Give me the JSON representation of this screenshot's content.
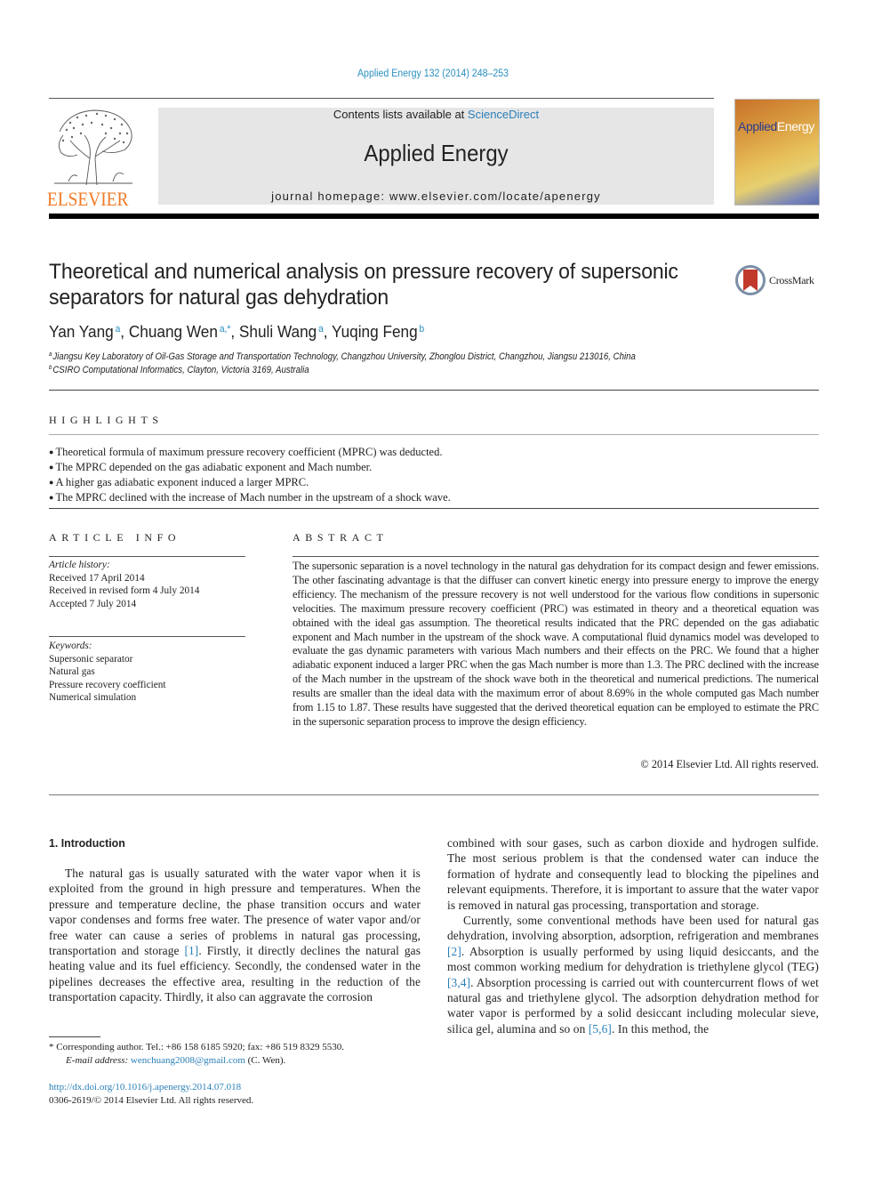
{
  "header": {
    "journal_reference": "Applied Energy 132 (2014) 248–253",
    "contents_prefix": "Contents lists available at ",
    "contents_link": "ScienceDirect",
    "journal_title": "Applied Energy",
    "homepage": "journal homepage: www.elsevier.com/locate/apenergy",
    "publisher_logo_text": "ELSEVIER",
    "cover_title_part1": "Applied",
    "cover_title_part2": "Energy",
    "crossmark_label": "CrossMark",
    "colors": {
      "link": "#2a8fc0",
      "elsevier_orange": "#f07a26",
      "masthead_bg": "#e6e6e6",
      "crossmark_red": "#c0392b"
    }
  },
  "article": {
    "title": "Theoretical and numerical analysis on pressure recovery of supersonic separators for natural gas dehydration",
    "authors": [
      {
        "name": "Yan Yang",
        "affil": "a"
      },
      {
        "name": "Chuang Wen",
        "affil": "a,*"
      },
      {
        "name": "Shuli Wang",
        "affil": "a"
      },
      {
        "name": "Yuqing Feng",
        "affil": "b"
      }
    ],
    "affiliations": [
      {
        "key": "a",
        "text": "Jiangsu Key Laboratory of Oil-Gas Storage and Transportation Technology, Changzhou University, Zhonglou District, Changzhou, Jiangsu 213016, China"
      },
      {
        "key": "b",
        "text": "CSIRO Computational Informatics, Clayton, Victoria 3169, Australia"
      }
    ]
  },
  "highlights": {
    "heading": "HIGHLIGHTS",
    "items": [
      "Theoretical formula of maximum pressure recovery coefficient (MPRC) was deducted.",
      "The MPRC depended on the gas adiabatic exponent and Mach number.",
      "A higher gas adiabatic exponent induced a larger MPRC.",
      "The MPRC declined with the increase of Mach number in the upstream of a shock wave."
    ]
  },
  "article_info": {
    "heading": "ARTICLE INFO",
    "history_label": "Article history:",
    "history": [
      "Received 17 April 2014",
      "Received in revised form 4 July 2014",
      "Accepted 7 July 2014"
    ],
    "keywords_label": "Keywords:",
    "keywords": [
      "Supersonic separator",
      "Natural gas",
      "Pressure recovery coefficient",
      "Numerical simulation"
    ]
  },
  "abstract": {
    "heading": "ABSTRACT",
    "text": "The supersonic separation is a novel technology in the natural gas dehydration for its compact design and fewer emissions. The other fascinating advantage is that the diffuser can convert kinetic energy into pressure energy to improve the energy efficiency. The mechanism of the pressure recovery is not well understood for the various flow conditions in supersonic velocities. The maximum pressure recovery coefficient (PRC) was estimated in theory and a theoretical equation was obtained with the ideal gas assumption. The theoretical results indicated that the PRC depended on the gas adiabatic exponent and Mach number in the upstream of the shock wave. A computational fluid dynamics model was developed to evaluate the gas dynamic parameters with various Mach numbers and their effects on the PRC. We found that a higher adiabatic exponent induced a larger PRC when the gas Mach number is more than 1.3. The PRC declined with the increase of the Mach number in the upstream of the shock wave both in the theoretical and numerical predictions. The numerical results are smaller than the ideal data with the maximum error of about 8.69% in the whole computed gas Mach number from 1.15 to 1.87. These results have suggested that the derived theoretical equation can be employed to estimate the PRC in the supersonic separation process to improve the design efficiency.",
    "copyright": "© 2014 Elsevier Ltd. All rights reserved."
  },
  "body": {
    "section_heading": "1. Introduction",
    "left_paragraph": {
      "text_before_ref": "The natural gas is usually saturated with the water vapor when it is exploited from the ground in high pressure and temperatures. When the pressure and temperature decline, the phase transition occurs and water vapor condenses and forms free water. The presence of water vapor and/or free water can cause a series of problems in natural gas processing, transportation and storage ",
      "ref1": "[1]",
      "text_after_ref": ". Firstly, it directly declines the natural gas heating value and its fuel efficiency. Secondly, the condensed water in the pipelines decreases the effective area, resulting in the reduction of the transportation capacity. Thirdly, it also can aggravate the corrosion"
    },
    "right_paragraph_1": "combined with sour gases, such as carbon dioxide and hydrogen sulfide. The most serious problem is that the condensed water can induce the formation of hydrate and consequently lead to blocking the pipelines and relevant equipments. Therefore, it is important to assure that the water vapor is removed in natural gas processing, transportation and storage.",
    "right_paragraph_2": {
      "part1": "Currently, some conventional methods have been used for natural gas dehydration, involving absorption, adsorption, refrigeration and membranes ",
      "ref2": "[2]",
      "part2": ". Absorption is usually performed by using liquid desiccants, and the most common working medium for dehydration is triethylene glycol (TEG) ",
      "ref3": "[3,4]",
      "part3": ". Absorption processing is carried out with countercurrent flows of wet natural gas and triethylene glycol. The adsorption dehydration method for water vapor is performed by a solid desiccant including molecular sieve, silica gel, alumina and so on ",
      "ref4": "[5,6]",
      "part4": ". In this method, the"
    }
  },
  "footnotes": {
    "corresponding": "* Corresponding author. Tel.: +86 158 6185 5920; fax: +86 519 8329 5530.",
    "email_label": "E-mail address: ",
    "email": "wenchuang2008@gmail.com",
    "email_suffix": " (C. Wen).",
    "doi": "http://dx.doi.org/10.1016/j.apenergy.2014.07.018",
    "issn": "0306-2619/© 2014 Elsevier Ltd. All rights reserved."
  }
}
